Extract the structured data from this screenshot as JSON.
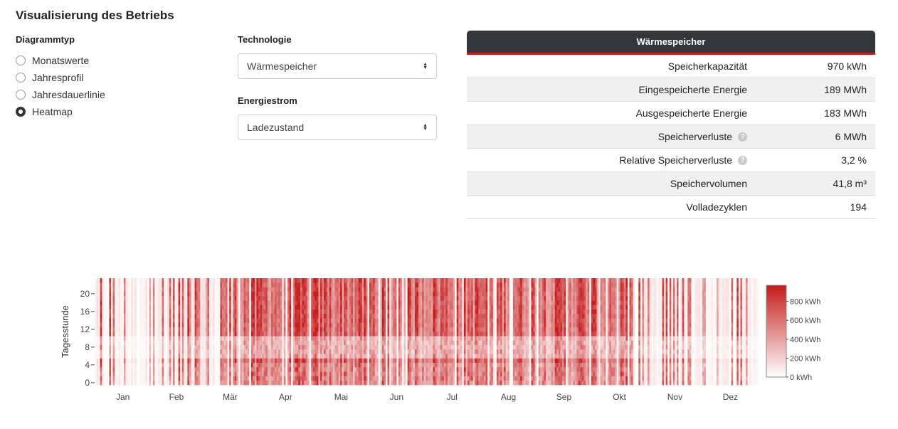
{
  "page": {
    "title": "Visualisierung des Betriebs"
  },
  "diagramm": {
    "label": "Diagrammtyp",
    "options": [
      {
        "label": "Monatswerte",
        "checked": false
      },
      {
        "label": "Jahresprofil",
        "checked": false
      },
      {
        "label": "Jahresdauerlinie",
        "checked": false
      },
      {
        "label": "Heatmap",
        "checked": true
      }
    ]
  },
  "technologie": {
    "label": "Technologie",
    "value": "Wärmespeicher"
  },
  "energiestrom": {
    "label": "Energiestrom",
    "value": "Ladezustand"
  },
  "card": {
    "title": "Wärmespeicher",
    "rows": [
      {
        "label": "Speicherkapazität",
        "value": "970 kWh",
        "help": false
      },
      {
        "label": "Eingespeicherte Energie",
        "value": "189 MWh",
        "help": false
      },
      {
        "label": "Ausgespeicherte Energie",
        "value": "183 MWh",
        "help": false
      },
      {
        "label": "Speicherverluste",
        "value": "6 MWh",
        "help": true
      },
      {
        "label": "Relative Speicherverluste",
        "value": "3,2 %",
        "help": true
      },
      {
        "label": "Speichervolumen",
        "value": "41,8 m³",
        "help": false
      },
      {
        "label": "Volladezyklen",
        "value": "194",
        "help": false
      }
    ]
  },
  "chart_data": {
    "type": "heatmap",
    "ylabel": "Tagesstunde",
    "xlabel": "",
    "title": "",
    "x_ticks": [
      "Jan",
      "Feb",
      "Mär",
      "Apr",
      "Mai",
      "Jun",
      "Jul",
      "Aug",
      "Sep",
      "Okt",
      "Nov",
      "Dez"
    ],
    "y_ticks": [
      0,
      4,
      8,
      12,
      16,
      20
    ],
    "x_range_days": [
      1,
      365
    ],
    "y_range_hours": [
      0,
      23
    ],
    "colorbar": {
      "ticks": [
        "0 kWh",
        "200 kWh",
        "400 kWh",
        "600 kWh",
        "800 kWh"
      ],
      "range": [
        0,
        970
      ]
    },
    "color_low": "#ffffff",
    "color_high": "#c51b1b"
  }
}
